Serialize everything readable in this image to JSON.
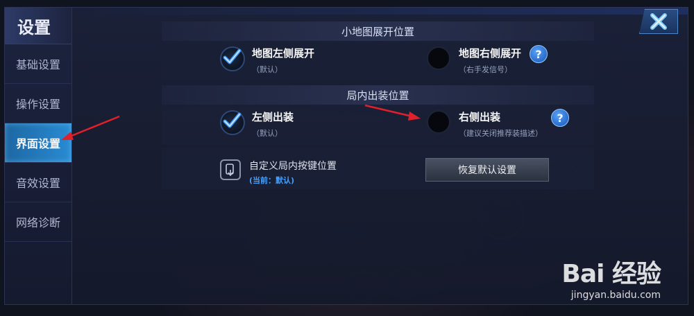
{
  "sidebar": {
    "title": "设置",
    "items": [
      {
        "label": "基础设置",
        "active": false
      },
      {
        "label": "操作设置",
        "active": false
      },
      {
        "label": "界面设置",
        "active": true
      },
      {
        "label": "音效设置",
        "active": false
      },
      {
        "label": "网络诊断",
        "active": false
      }
    ]
  },
  "close": {
    "icon": "close-x-icon"
  },
  "minimap": {
    "title": "小地图展开位置",
    "left": {
      "label": "地图左侧展开",
      "note": "（默认）",
      "selected": true
    },
    "right": {
      "label": "地图右侧展开",
      "note": "（右手发信号）",
      "selected": false,
      "help": "?"
    }
  },
  "equip": {
    "title": "局内出装位置",
    "left": {
      "label": "左侧出装",
      "note": "（默认）",
      "selected": true
    },
    "right": {
      "label": "右侧出装",
      "note": "（建议关闭推荐装描述）",
      "selected": false,
      "help": "?"
    }
  },
  "custom": {
    "label": "自定义局内按键位置",
    "current": "(当前：默认)",
    "restore_label": "恢复默认设置"
  },
  "watermark": {
    "logo": "Bai 经验",
    "url": "jingyan.baidu.com"
  },
  "colors": {
    "accent": "#2a90d8",
    "help": "#2b6fd0",
    "current_text": "#4aa3ff"
  }
}
